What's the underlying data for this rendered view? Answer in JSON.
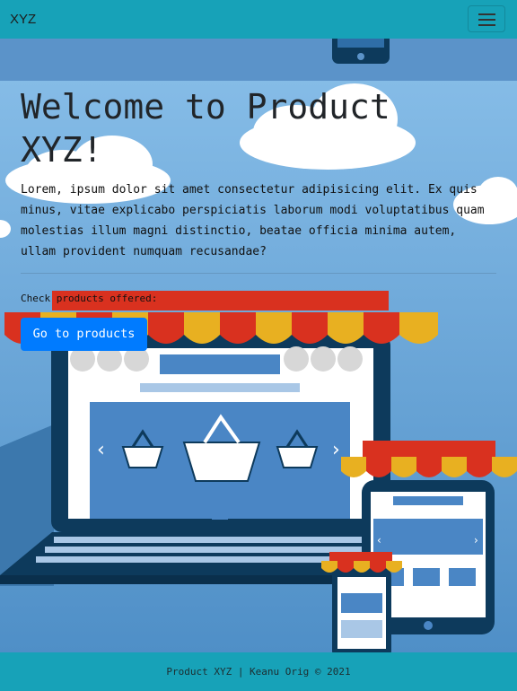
{
  "navbar": {
    "brand": "XYZ",
    "menu_icon": "hamburger-menu-icon"
  },
  "hero": {
    "title": "Welcome to Product XYZ!",
    "lead": "Lorem, ipsum dolor sit amet consectetur adipisicing elit. Ex quis minus, vitae explicabo perspiciatis laborum modi voluptatibus quam molestias illum magni distinctio, beatae officia minima autem, ullam provident numquam recusandae?",
    "check_text": "Check products offered:",
    "button_label": "Go to products"
  },
  "footer": {
    "text": "Product XYZ | Keanu Orig © 2021"
  },
  "colors": {
    "navbar": "#17a2b8",
    "button": "#007bff",
    "sky": "#6aa9dc",
    "awning_red": "#d9311f",
    "awning_yellow": "#e8b021"
  }
}
